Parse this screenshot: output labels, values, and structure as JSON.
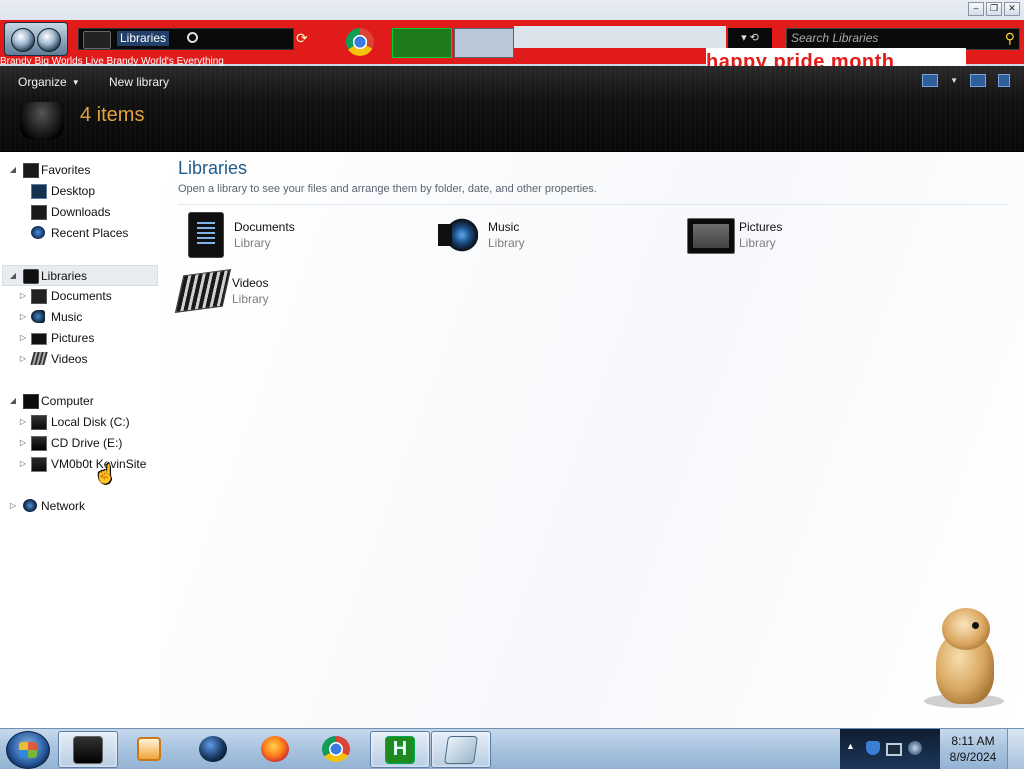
{
  "address_bar": {
    "path": "Libraries",
    "search_placeholder": "Search Libraries"
  },
  "window_buttons": {
    "minimize": "–",
    "restore": "❐",
    "close": "✕"
  },
  "banner": {
    "scrolling_text": "Brandy Big Worlds    Live Brandy World's Everything",
    "pride_text": "happy pride month",
    "color": "#e11a1a"
  },
  "toolbar": {
    "organize_label": "Organize",
    "new_library_label": "New library",
    "item_count": "4 items"
  },
  "nav": {
    "favorites": {
      "label": "Favorites",
      "items": [
        {
          "label": "Desktop",
          "icon": "desktop-icon"
        },
        {
          "label": "Downloads",
          "icon": "downloads-icon"
        },
        {
          "label": "Recent Places",
          "icon": "recent-places-icon"
        }
      ]
    },
    "libraries": {
      "label": "Libraries",
      "items": [
        {
          "label": "Documents",
          "icon": "documents-icon"
        },
        {
          "label": "Music",
          "icon": "music-icon"
        },
        {
          "label": "Pictures",
          "icon": "pictures-icon"
        },
        {
          "label": "Videos",
          "icon": "videos-icon"
        }
      ]
    },
    "computer": {
      "label": "Computer",
      "items": [
        {
          "label": "Local Disk (C:)",
          "icon": "hard-disk-icon"
        },
        {
          "label": "CD Drive (E:)",
          "icon": "cd-drive-icon"
        },
        {
          "label": "VM0b0t KevinSite",
          "icon": "network-drive-icon"
        }
      ]
    },
    "network": {
      "label": "Network"
    }
  },
  "content": {
    "title": "Libraries",
    "subtitle": "Open a library to see your files and arrange them by folder, date, and other properties.",
    "libraries": [
      {
        "name": "Documents",
        "type": "Library",
        "icon": "documents-library-icon"
      },
      {
        "name": "Music",
        "type": "Library",
        "icon": "music-library-icon"
      },
      {
        "name": "Pictures",
        "type": "Library",
        "icon": "pictures-library-icon"
      },
      {
        "name": "Videos",
        "type": "Library",
        "icon": "videos-library-icon"
      }
    ]
  },
  "taskbar": {
    "items": [
      {
        "name": "explorer",
        "icon": "explorer-icon",
        "active": true
      },
      {
        "name": "media player",
        "icon": "media-player-icon",
        "active": false
      },
      {
        "name": "globe",
        "icon": "globe-icon",
        "active": false
      },
      {
        "name": "firefox",
        "icon": "firefox-icon",
        "active": false
      },
      {
        "name": "chrome",
        "icon": "chrome-icon",
        "active": false
      },
      {
        "name": "h app",
        "icon": "h-app-icon",
        "active": true
      },
      {
        "name": "notepad",
        "icon": "notepad-icon",
        "active": true
      }
    ],
    "h_glyph": "H",
    "tray_arrow": "▲"
  },
  "clock": {
    "time": "8:11 AM",
    "date": "8/9/2024"
  }
}
